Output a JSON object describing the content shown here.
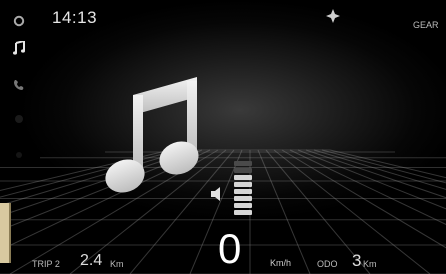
{
  "status": {
    "time": "14:13",
    "gear_label": "GEAR"
  },
  "sidebar": {
    "items": [
      {
        "icon": "music-icon"
      },
      {
        "icon": "phone-icon"
      }
    ]
  },
  "media": {
    "icon": "music-note-icon",
    "volume_level": 0.75
  },
  "dashboard": {
    "speed": "0",
    "speed_unit": "Km/h",
    "trip_label": "TRIP 2",
    "trip_value": "2.4",
    "trip_unit": "Km",
    "odo_label": "ODO",
    "odo_value": "3",
    "odo_unit": "Km"
  },
  "colors": {
    "background": "#000000",
    "text": "#dddddd",
    "highlight": "#ffffff"
  }
}
